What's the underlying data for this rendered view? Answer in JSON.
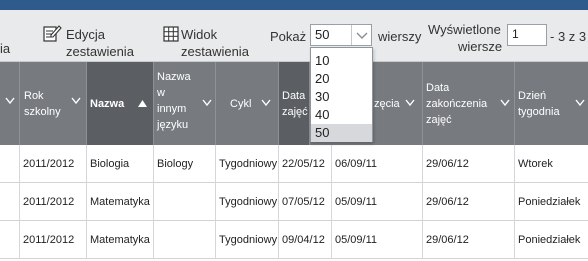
{
  "toolbar": {
    "edit_label": "Edycja zestawienia",
    "edit_line1": "Edycja",
    "edit_line2": "zestawienia",
    "view_line1": "Widok",
    "view_line2": "zestawienia",
    "left_cut": "ia",
    "show_label": "Pokaż",
    "page_size": "50",
    "rows_suffix": "wierszy",
    "displayed_line1": "Wyświetlone",
    "displayed_line2": "wiersze",
    "rows_from": "1",
    "rows_range": "- 3 z 3"
  },
  "page_size_options": [
    "10",
    "20",
    "30",
    "40",
    "50"
  ],
  "page_size_selected": "50",
  "columns": [
    {
      "key": "school_year",
      "label": "Rok szkolny",
      "line1": "Rok",
      "line2": "szkolny"
    },
    {
      "key": "name",
      "label": "Nazwa",
      "sorted": "asc"
    },
    {
      "key": "name_other",
      "label": "Nazwa w innym języku",
      "line1": "Nazwa",
      "line2": "w",
      "line3": "innym",
      "line4": "języku"
    },
    {
      "key": "cycle",
      "label": "Cykl"
    },
    {
      "key": "date_a",
      "label": "Data zajęć",
      "line1": "Data",
      "line2": "zajęć"
    },
    {
      "key": "date_start",
      "label": "zęcia",
      "line1": "zęcia"
    },
    {
      "key": "date_end",
      "label": "Data zakończenia zajęć",
      "line1": "Data",
      "line2": "zakończenia",
      "line3": "zajęć"
    },
    {
      "key": "weekday",
      "label": "Dzień tygodnia",
      "line1": "Dzień",
      "line2": "tygodnia"
    }
  ],
  "rows": [
    {
      "school_year": "2011/2012",
      "name": "Biologia",
      "name_other": "Biology",
      "cycle": "Tygodniowy",
      "date_a": "22/05/12",
      "date_start": "06/09/11",
      "date_end": "29/06/12",
      "weekday": "Wtorek"
    },
    {
      "school_year": "2011/2012",
      "name": "Matematyka",
      "name_other": "",
      "cycle": "Tygodniowy",
      "date_a": "07/05/12",
      "date_start": "05/09/11",
      "date_end": "29/06/12",
      "weekday": "Poniedziałek"
    },
    {
      "school_year": "2011/2012",
      "name": "Matematyka",
      "name_other": "",
      "cycle": "Tygodniowy",
      "date_a": "09/04/12",
      "date_start": "05/09/11",
      "date_end": "29/06/12",
      "weekday": "Poniedziałek"
    }
  ]
}
